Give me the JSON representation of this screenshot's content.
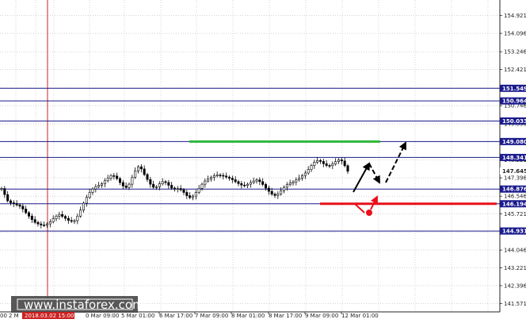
{
  "chart_data": {
    "type": "candlestick",
    "price_ticks": [
      "154.921",
      "154.096",
      "153.246",
      "152.421",
      "151.571",
      "150.746",
      "149.896",
      "149.071",
      "148.221",
      "147.396",
      "146.546",
      "145.721",
      "144.871",
      "144.046",
      "143.221",
      "142.396",
      "141.571"
    ],
    "time_ticks": [
      "6 Mar 17:00",
      "7 Mar 09:00",
      "8 Mar 01:00",
      "8 Mar 17:00",
      "9 Mar 09:00",
      "12 Mar 01:00"
    ],
    "time_ticks_left": [
      "00",
      "2 M",
      "0 Mar 09:00",
      "5 Mar 01:00"
    ],
    "highlighted_time": "2018.03.02 15:00",
    "current_price": "147.645",
    "ylim": [
      141.4,
      155.35
    ],
    "levels": [
      {
        "price": 151.549,
        "label": "151.549",
        "color": "#1a1a8c"
      },
      {
        "price": 150.964,
        "label": "150.964",
        "color": "#1a1a8c"
      },
      {
        "price": 150.033,
        "label": "150.033",
        "color": "#1a1a8c"
      },
      {
        "price": 149.08,
        "label": "149.080",
        "color": "#1a1a8c"
      },
      {
        "price": 148.341,
        "label": "148.341",
        "color": "#1a1a8c"
      },
      {
        "price": 146.876,
        "label": "146.876",
        "color": "#1a1a8c"
      },
      {
        "price": 146.194,
        "label": "146.194",
        "color": "#1a1a8c"
      },
      {
        "price": 144.931,
        "label": "144.931",
        "color": "#1a1a8c"
      }
    ],
    "green_level": 149.08,
    "red_level": 146.194,
    "close_series": [
      146.9,
      146.62,
      146.33,
      146.24,
      146.2,
      146.14,
      146.08,
      145.95,
      145.78,
      145.62,
      145.46,
      145.33,
      145.26,
      145.21,
      145.2,
      145.26,
      145.36,
      145.5,
      145.62,
      145.7,
      145.61,
      145.52,
      145.42,
      145.38,
      145.41,
      145.62,
      145.9,
      146.22,
      146.49,
      146.72,
      146.88,
      146.99,
      147.05,
      147.12,
      147.26,
      147.38,
      147.5,
      147.48,
      147.36,
      147.18,
      147.02,
      146.95,
      147.1,
      147.42,
      147.72,
      147.91,
      147.81,
      147.55,
      147.32,
      147.1,
      146.96,
      146.98,
      147.12,
      147.22,
      147.18,
      147.05,
      146.92,
      146.88,
      146.9,
      146.84,
      146.72,
      146.57,
      146.48,
      146.55,
      146.72,
      146.91,
      147.1,
      147.25,
      147.34,
      147.42,
      147.49,
      147.53,
      147.51,
      147.48,
      147.43,
      147.38,
      147.31,
      147.22,
      147.13,
      147.06,
      147.04,
      147.1,
      147.18,
      147.25,
      147.3,
      147.22,
      147.09,
      146.92,
      146.77,
      146.64,
      146.58,
      146.65,
      146.8,
      146.96,
      147.08,
      147.15,
      147.21,
      147.3,
      147.38,
      147.5,
      147.62,
      147.78,
      147.97,
      148.12,
      148.2,
      148.16,
      148.05,
      147.97,
      147.96,
      148.04,
      148.15,
      148.23,
      148.18,
      147.96,
      147.7
    ],
    "forecast_up_color": "#000000",
    "forecast_down_color": "#e8101b"
  },
  "watermark": {
    "text": "www.instaforex.com"
  },
  "colors": {
    "line": "#1a1a8c",
    "green": "#2db83d",
    "red": "#e8101b",
    "candle": "#000000",
    "vline": "#cc2020"
  }
}
